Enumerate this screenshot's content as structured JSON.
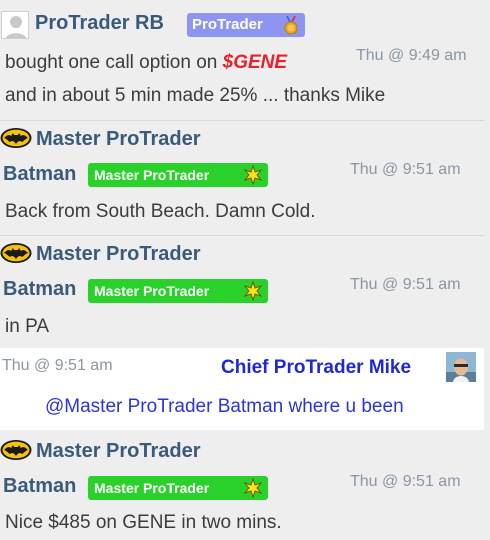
{
  "messages": [
    {
      "author": "ProTrader RB",
      "badge": "ProTrader",
      "badge_icon": "medal-icon",
      "time": "Thu @ 9:49 am",
      "line1_prefix": "bought one call option on ",
      "ticker": "$GENE",
      "line2": "and in about 5 min made 25% ... thanks Mike"
    },
    {
      "author_line1": "Master ProTrader",
      "author_line2": "Batman",
      "badge": "Master ProTrader",
      "badge_icon": "sparkle-star-icon",
      "avatar_icon": "batman-logo-icon",
      "time": "Thu @ 9:51 am",
      "text": "Back from South Beach.  Damn Cold."
    },
    {
      "author_line1": "Master ProTrader",
      "author_line2": "Batman",
      "badge": "Master ProTrader",
      "badge_icon": "sparkle-star-icon",
      "avatar_icon": "batman-logo-icon",
      "time": "Thu @ 9:51 am",
      "text": "in PA"
    },
    {
      "author": "Chief ProTrader Mike",
      "avatar_icon": "profile-photo-icon",
      "time": "Thu @ 9:51 am",
      "text": "@Master ProTrader Batman where u been"
    },
    {
      "author_line1": "Master ProTrader",
      "author_line2": "Batman",
      "badge": "Master ProTrader",
      "badge_icon": "sparkle-star-icon",
      "avatar_icon": "batman-logo-icon",
      "time": "Thu @ 9:51 am",
      "text": "Nice $485 on GENE in two mins."
    }
  ],
  "colors": {
    "name": "#3b5a7a",
    "green_badge": "#2bd12b",
    "purple_badge": "#8e95f0",
    "ticker": "#e8202a",
    "chief_blue": "#1f28d6"
  }
}
